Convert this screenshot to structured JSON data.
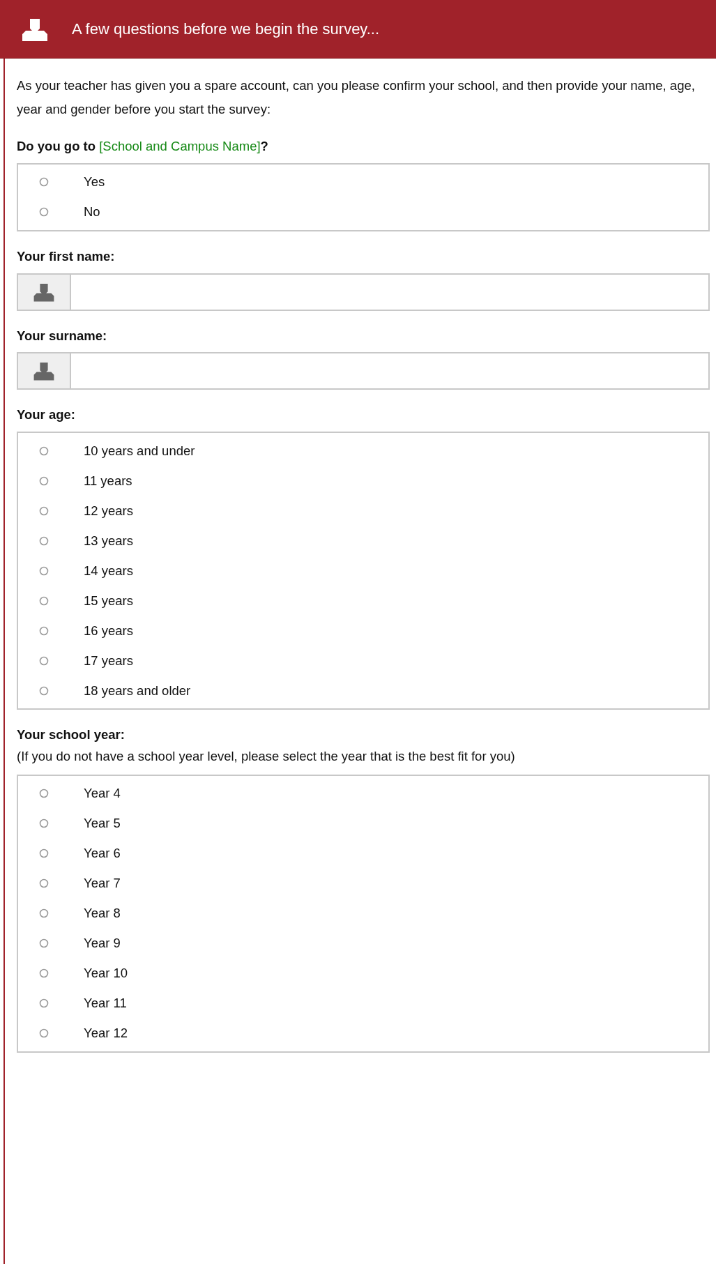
{
  "header": {
    "title": "A few questions before we begin the survey..."
  },
  "intro": "As your teacher has given you a spare account, can you please confirm your school, and then provide your name, age, year and gender before you start the survey:",
  "questions": [
    {
      "kind": "radio",
      "label": "Do you go to ",
      "label_highlight": "[School and Campus Name]",
      "label_end": "?",
      "options": [
        {
          "label": "Yes",
          "selected": false
        },
        {
          "label": "No",
          "selected": false
        }
      ]
    },
    {
      "kind": "text",
      "label": "Your first name:"
    },
    {
      "kind": "text",
      "label": "Your surname:"
    },
    {
      "kind": "radio",
      "label": "Your age:",
      "options": [
        {
          "label": "10 years and under",
          "selected": false
        },
        {
          "label": "11 years",
          "selected": false
        },
        {
          "label": "12 years",
          "selected": false
        },
        {
          "label": "13 years",
          "selected": false
        },
        {
          "label": "14 years",
          "selected": false
        },
        {
          "label": "15 years",
          "selected": false
        },
        {
          "label": "16 years",
          "selected": false
        },
        {
          "label": "17 years",
          "selected": false
        },
        {
          "label": "18 years and older",
          "selected": false
        }
      ]
    },
    {
      "kind": "radio",
      "label": "Your school year:",
      "note": "(If you do not have a school year level, please select the year that is the best fit for you)",
      "options": [
        {
          "label": "Year 4",
          "selected": false
        },
        {
          "label": "Year 5",
          "selected": false
        },
        {
          "label": "Year 6",
          "selected": false
        },
        {
          "label": "Year 7",
          "selected": false
        },
        {
          "label": "Year 8",
          "selected": false
        },
        {
          "label": "Year 9",
          "selected": false
        },
        {
          "label": "Year 10",
          "selected": false
        },
        {
          "label": "Year 11",
          "selected": false
        },
        {
          "label": "Year 12",
          "selected": false
        }
      ]
    }
  ]
}
